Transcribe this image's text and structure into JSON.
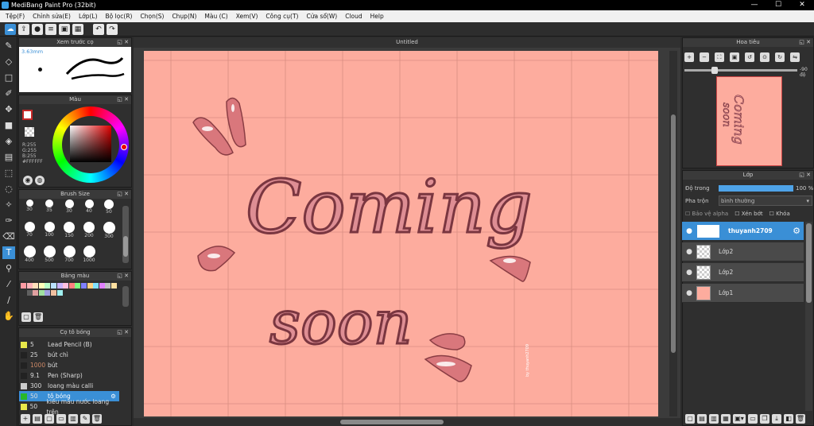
{
  "window": {
    "title": "MediBang Paint Pro (32bit)",
    "buttons": [
      "—",
      "☐",
      "✕"
    ]
  },
  "menu": [
    "Tệp(F)",
    "Chỉnh sửa(E)",
    "Lớp(L)",
    "Bộ lọc(R)",
    "Chọn(S)",
    "Chụp(N)",
    "Màu (C)",
    "Xem(V)",
    "Công cụ(T)",
    "Cửa sổ(W)",
    "Cloud",
    "Help"
  ],
  "toolbar_icons": [
    "cloud-icon",
    "export-icon",
    "comment-icon",
    "stack-icon",
    "save-icon",
    "grid-icon",
    "undo-icon",
    "redo-icon"
  ],
  "tools": [
    "brush-icon",
    "eraser-icon",
    "rect-icon",
    "pen-icon",
    "move-icon",
    "fill-rect-icon",
    "bucket-icon",
    "gradient-icon",
    "select-icon",
    "lasso-icon",
    "magic-wand-icon",
    "select-pen-icon",
    "select-eraser-icon",
    "text-icon",
    "operation-icon",
    "eyedropper-icon",
    "dropper-icon",
    "hand-icon"
  ],
  "brush_preview": {
    "title": "Xem trước cọ",
    "size": "3.63mm"
  },
  "color_panel": {
    "title": "Màu",
    "r": "R:255",
    "g": "G:255",
    "b": "B:255",
    "hex": "#FFFFFF",
    "primary": "#ffffff",
    "accent": "#c62828"
  },
  "brush_size": {
    "title": "Brush Size",
    "sizes": [
      "30",
      "35",
      "30",
      "40",
      "50",
      "70",
      "100",
      "150",
      "200",
      "300",
      "400",
      "500",
      "700",
      "1000"
    ]
  },
  "palette": {
    "title": "Bảng màu",
    "colors": [
      "#ff9aa2",
      "#ffb3ba",
      "#ffdfba",
      "#ffffba",
      "#baffc9",
      "#bae1ff",
      "#c9b3ff",
      "#ffc0e0",
      "#ff8080",
      "#80ff80",
      "#8080ff",
      "#ffd080",
      "#80e0ff",
      "#e080ff",
      "#c0c0c0",
      "#ffe0a0",
      "#303030",
      "#606060",
      "#e0a0a0",
      "#a0e0a0",
      "#a0a0e0",
      "#f0c0a0",
      "#a0f0f0"
    ]
  },
  "brush_list": {
    "title": "Cọ tô bóng",
    "items": [
      {
        "size": "5",
        "name": "Lead Pencil (B)",
        "color": "#e8e84a"
      },
      {
        "size": "25",
        "name": "bút chì",
        "color": "#222222"
      },
      {
        "size": "1000",
        "name": "bút",
        "color": "#222222"
      },
      {
        "size": "9.1",
        "name": "Pen (Sharp)",
        "color": "#222222"
      },
      {
        "size": "300",
        "name": "loang màu calli",
        "color": "#cccccc"
      },
      {
        "size": "50",
        "name": "tô bóng",
        "color": "#28b828"
      },
      {
        "size": "50",
        "name": "kiểu màu nước loang trên",
        "color": "#e8e84a"
      }
    ]
  },
  "canvas": {
    "tab": "Untitled",
    "text_line1": "Coming",
    "text_line2": "soon",
    "signature": "by thuyanh2709",
    "bg": "#fdac9e"
  },
  "navigator": {
    "title": "Hoa tiêu",
    "angle": "-90 độ"
  },
  "layers": {
    "title": "Lớp",
    "opacity_label": "Độ trong",
    "opacity_value": "100 %",
    "blend_label": "Pha trộn",
    "blend_value": "bình thường",
    "protect_alpha": "Bảo vệ alpha",
    "clipping": "Xén bớt",
    "lock": "Khóa",
    "items": [
      {
        "name": "thuyanh2709",
        "selected": true
      },
      {
        "name": "Lớp2",
        "selected": false
      },
      {
        "name": "Lớp2",
        "selected": false
      },
      {
        "name": "Lớp1",
        "selected": false
      }
    ]
  }
}
